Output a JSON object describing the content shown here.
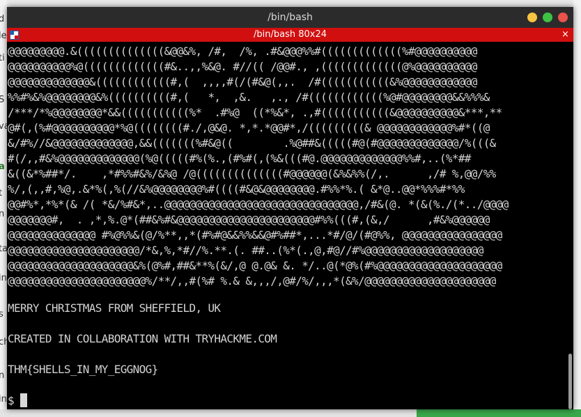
{
  "window": {
    "title": "/bin/bash",
    "tab_title": "/bin/bash 80x24",
    "close_glyph": "×"
  },
  "background_window": {
    "edge_chars": [
      "d",
      "le",
      "ti",
      "S",
      "va",
      "a",
      "t",
      "n",
      "ta",
      "in",
      "s",
      "ch",
      "n",
      "in"
    ]
  },
  "terminal": {
    "ascii_art": [
      "@@@@@@@@@.&((((((((((((((&@@&%, /#,  /%, .#&@@@%%#(((((((((((((%#@@@@@@@@@@",
      "@@@@@@@@@@%@(((((((((((((#&..,,%&@. #//(( /@@#., ,(((((((((((((@%@@@@@@@@@@",
      "@@@@@@@@@@@@@&((((((((((((#,(  ,,,,#(/(#&@(,,.  /#(((((((((((&%@@@@@@@@@@@@",
      "%%#%&%@@@@@@@@&%((((((((((#,(   *,  ,&.   ,., /#((((((((((((%@#@@@@@@@@&&%%%&",
      "/***/*%@@@@@@@@*&&(((((((((((%*  .#%@  ((*%&*, .,#(((((((((((&@@@@@@@@@@&***,**",
      "@#(,(%#@@@@@@@@@@*%@((((((((#./,@&@. *,*.*@@#*,/(((((((((& @@@@@@@@@@@@%#*((@",
      "&/#%//&@@@@@@@@@@@@@,&&(((((((%#&@((        .%@##&(((((#@(#@@@@@@@@@@@@@/%(((&",
      "#(/,,#&%@@@@@@@@@@@@@(%@(((((#%(%.,(#%#(,(%&(((#@.@@@@@@@@@@@@@%%#,..(%*##",
      "&((&*%##*/.    ,*#%%#&%/&%@ /@((((((((((((((#@@@@@@(&%&%%(/,.      ,/# %,@@/%%",
      "%/,(,,#,%@,.&*%(,%(//&%@@@@@@@@%#((((#&@&@@@@@@@@.#%%*%.( &*@..@@*%%%#*%%",
      "@@#%*,*%*(& /( *&/%#&*,..@@@@@@@@@@@@@@@@@@@@@@@@@@@@@@@,/#&(@. *(&(%./(*../@@@@",
      "@@@@@@@#,  . ,*,%.@*(##&%#&@@@@@@@@@@@@@@@@@@@@@@#%%(((#,(&,/      ,#&%@@@@@@",
      "@@@@@@@@@@@@@@ #%@%%&(@/%**,,*(#%#@&&%%&&@#%##*,...*#/@/(#@%%, @@@@@@@@@@@@@@@@",
      "@@@@@@@@@@@@@@@@@@@@@/*&,%,*#//%.**.(. ##..(%*(.,@,#@//#%@@@@@@@@@@@@@@@@@@@",
      "@@@@@@@@@@@@@@@@@@@@&%(@%#,##&**%(&/,@ @.@& &. */..@(*@%(#%@@@@@@@@@@@@@@@@@@@@",
      "@@@@@@@@@@@@@@@@@@@@@@%/**/,,#(%# %.& &,,,/,@#/%/,,,*(&%/@@@@@@@@@@@@@@@@@@@@@"
    ],
    "message_1": "MERRY CHRISTMAS FROM SHEFFIELD, UK",
    "message_2": "CREATED IN COLLABORATION WITH TRYHACKME.COM",
    "message_3": "THM{SHELLS_IN_MY_EGGNOG}",
    "prompt": "$"
  },
  "colors": {
    "titlebar": "#2b2b2b",
    "tabbar": "#d10f0f",
    "terminal_bg": "#000000",
    "terminal_fg": "#d2d2d2",
    "btn_minimize": "#f6c342",
    "btn_maximize": "#3ec244",
    "btn_close": "#e9534c"
  }
}
